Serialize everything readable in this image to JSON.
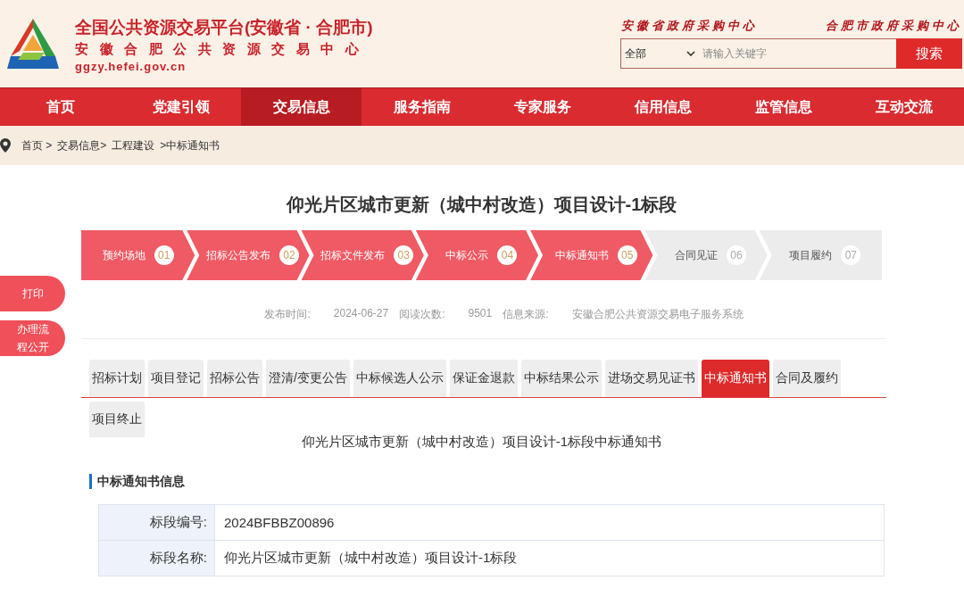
{
  "header": {
    "title": "全国公共资源交易平台(安徽省 · 合肥市)",
    "subtitle": "安徽合肥公共资源交易中心",
    "url": "ggzy.hefei.gov.cn",
    "links": [
      "安徽省政府采购中心",
      "合肥市政府采购中心"
    ],
    "search": {
      "scope": "全部",
      "placeholder": "请输入关键字",
      "button": "搜索"
    }
  },
  "nav": [
    {
      "label": "首页",
      "selected": false
    },
    {
      "label": "党建引领",
      "selected": false
    },
    {
      "label": "交易信息",
      "selected": true
    },
    {
      "label": "服务指南",
      "selected": false
    },
    {
      "label": "专家服务",
      "selected": false
    },
    {
      "label": "信用信息",
      "selected": false
    },
    {
      "label": "监管信息",
      "selected": false
    },
    {
      "label": "互动交流",
      "selected": false
    }
  ],
  "breadcrumb": [
    "首页 >",
    "交易信息>",
    "工程建设",
    ">中标通知书"
  ],
  "side_buttons": [
    "打印",
    "办理流程公开"
  ],
  "title": "仰光片区城市更新（城中村改造）项目设计-1标段",
  "steps": [
    {
      "label": "预约场地",
      "number": "01",
      "done": true
    },
    {
      "label": "招标公告发布",
      "number": "02",
      "done": true
    },
    {
      "label": "招标文件发布",
      "number": "03",
      "done": true
    },
    {
      "label": "中标公示",
      "number": "04",
      "done": true
    },
    {
      "label": "中标通知书",
      "number": "05",
      "done": true
    },
    {
      "label": "合同见证",
      "number": "06",
      "done": false
    },
    {
      "label": "项目履约",
      "number": "07",
      "done": false
    }
  ],
  "meta": [
    {
      "label": "发布时间:",
      "value": "2024-06-27"
    },
    {
      "label": "阅读次数:",
      "value": "9501"
    },
    {
      "label": "信息来源:",
      "value": "安徽合肥公共资源交易电子服务系统"
    }
  ],
  "tabs": [
    {
      "label": "招标计划",
      "selected": false
    },
    {
      "label": "项目登记",
      "selected": false
    },
    {
      "label": "招标公告",
      "selected": false
    },
    {
      "label": "澄清/变更公告",
      "selected": false
    },
    {
      "label": "中标候选人公示",
      "selected": false
    },
    {
      "label": "保证金退款",
      "selected": false
    },
    {
      "label": "中标结果公示",
      "selected": false
    },
    {
      "label": "进场交易见证书",
      "selected": false
    },
    {
      "label": "中标通知书",
      "selected": true
    },
    {
      "label": "合同及履约",
      "selected": false
    },
    {
      "label": "项目终止",
      "selected": false
    }
  ],
  "notice_title": "仰光片区城市更新（城中村改造）项目设计-1标段中标通知书",
  "section_heading": "中标通知书信息",
  "table": {
    "rows": [
      {
        "label": "标段编号:",
        "value": "2024BFBBZ00896"
      },
      {
        "label": "标段名称:",
        "value": "仰光片区城市更新（城中村改造）项目设计-1标段"
      }
    ]
  }
}
